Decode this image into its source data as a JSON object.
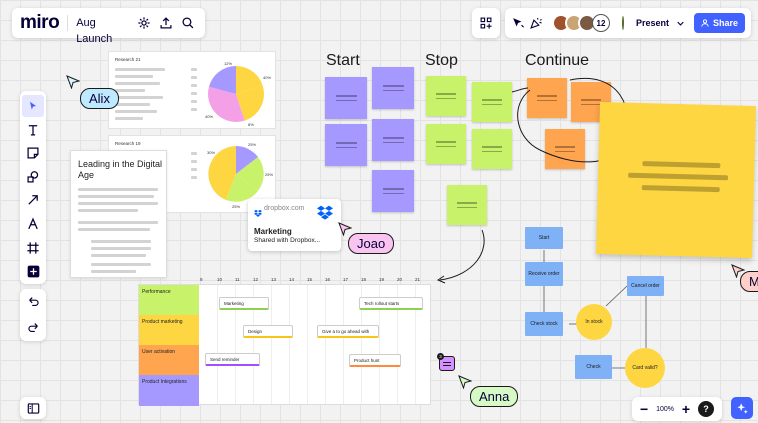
{
  "app": {
    "logo": "miro",
    "board_title": "Aug Launch"
  },
  "toolbar": {
    "present_label": "Present",
    "share_label": "Share",
    "collaborator_count": "12"
  },
  "zoom": {
    "level": "100%"
  },
  "help_label": "?",
  "cursors": {
    "alix": "Alix",
    "joao": "Joao",
    "anna": "Anna",
    "ma": "Ma"
  },
  "reports": [
    {
      "title": "Research 21",
      "labels": [
        "12%",
        "40%",
        "40%",
        "8%"
      ]
    },
    {
      "title": "Research 19",
      "labels": [
        "30%",
        "25%",
        "25%",
        "25%"
      ]
    }
  ],
  "doc_card": {
    "title": "Leading in the Digital Age"
  },
  "dropbox": {
    "domain": "dropbox.com",
    "name": "Marketing",
    "subtitle": "Shared with Dropbox..."
  },
  "retro": {
    "start": "Start",
    "stop": "Stop",
    "continue": "Continue"
  },
  "timeline": {
    "days": [
      "9",
      "10",
      "11",
      "12",
      "13",
      "14",
      "15",
      "16",
      "17",
      "18",
      "19",
      "20",
      "21"
    ],
    "rows": [
      "Performance",
      "Product marketing",
      "User activation",
      "Product Integrations"
    ],
    "tasks": {
      "marketing": "Marketing",
      "tech_rollout": "Tech rollout starts",
      "design": "Design",
      "go_ahead": "Give a to go ahead with",
      "send_reminder": "Send reminder",
      "product_hunt": "Product hunt"
    }
  },
  "flow": {
    "start": "Start",
    "receive_order": "Receive order",
    "check_stock": "Check stock",
    "in_stock": "In stock",
    "cancel_order": "Cancel order",
    "check": "Check",
    "card_valid": "Card valid?"
  },
  "comment_count": "3",
  "colors": {
    "accent": "#4262ff",
    "sticky_purple": "#a599ff",
    "sticky_green": "#c9f26b",
    "sticky_orange": "#ffa44f",
    "sticky_yellow": "#fed642",
    "flow_blue": "#7fb1f7"
  }
}
